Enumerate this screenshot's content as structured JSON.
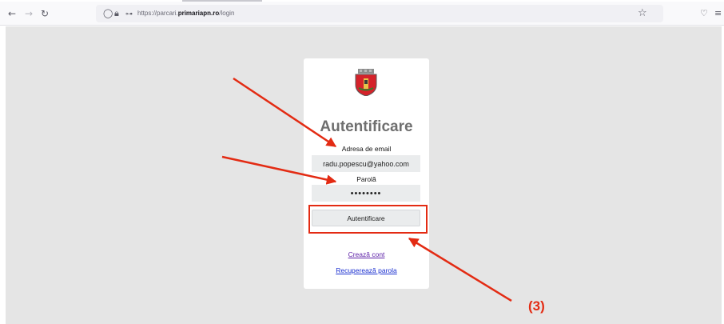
{
  "browser": {
    "back_icon": "back-arrow-icon",
    "forward_icon": "forward-arrow-icon",
    "reload_icon": "reload-icon",
    "url_prefix": "https://parcari.",
    "url_domain": "primariapn.ro",
    "url_path": "/login",
    "bookmark_icon": "star-icon",
    "pocket_icon": "pocket-icon",
    "menu_icon": "hamburger-menu-icon"
  },
  "login": {
    "title": "Autentificare",
    "email_label": "Adresa de email",
    "email_value": "radu.popescu@yahoo.com",
    "password_label": "Parolă",
    "password_value": "••••••••",
    "submit_label": "Autentificare",
    "create_account_link": "Crează cont",
    "recover_password_link": "Recuperează parola"
  },
  "annotation": {
    "step_label": "(3)",
    "color": "#e32b13"
  }
}
